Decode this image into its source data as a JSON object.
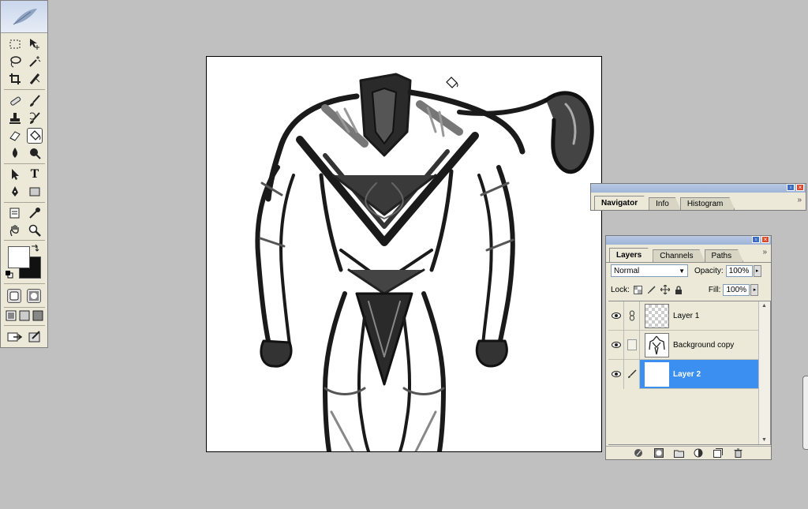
{
  "toolbox": {
    "tools": [
      "marquee-tool",
      "move-tool",
      "lasso-tool",
      "magic-wand-tool",
      "crop-tool",
      "slice-tool",
      "healing-brush-tool",
      "brush-tool",
      "clone-stamp-tool",
      "history-brush-tool",
      "eraser-tool",
      "paint-bucket-tool",
      "blur-tool",
      "dodge-tool",
      "path-selection-tool",
      "type-tool",
      "pen-tool",
      "shape-tool",
      "notes-tool",
      "eyedropper-tool",
      "hand-tool",
      "zoom-tool"
    ],
    "type_glyph": "T",
    "foreground_color": "#ffffff",
    "background_color": "#111111"
  },
  "navigator": {
    "tabs": [
      "Navigator",
      "Info",
      "Histogram"
    ],
    "active_tab": "Navigator"
  },
  "layers_panel": {
    "tabs": [
      "Layers",
      "Channels",
      "Paths"
    ],
    "active_tab": "Layers",
    "blend_mode": "Normal",
    "opacity_label": "Opacity:",
    "opacity_value": "100%",
    "lock_label": "Lock:",
    "fill_label": "Fill:",
    "fill_value": "100%",
    "layers": [
      {
        "name": "Layer 1",
        "visible": true,
        "selected": false
      },
      {
        "name": "Background copy",
        "visible": true,
        "selected": false
      },
      {
        "name": "Layer 2",
        "visible": true,
        "selected": true
      }
    ]
  },
  "colors": {
    "selection": "#3a8ff0",
    "workspace": "#c0c0c0"
  }
}
